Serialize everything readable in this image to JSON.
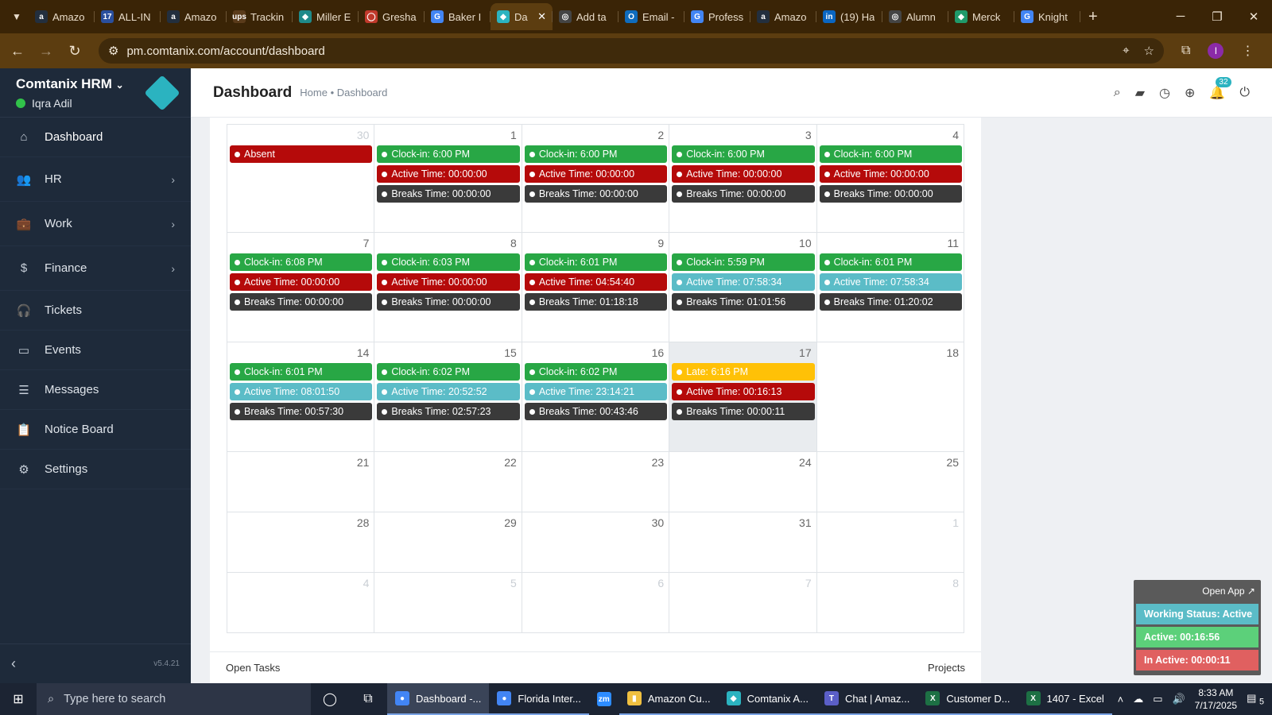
{
  "browser": {
    "tabs": [
      {
        "label": "Amazo",
        "fav": "a",
        "color": "#232f3e"
      },
      {
        "label": "ALL-IN",
        "fav": "17",
        "color": "#2a4f9e"
      },
      {
        "label": "Amazo",
        "fav": "a",
        "color": "#232f3e"
      },
      {
        "label": "Trackin",
        "fav": "ups",
        "color": "#5a3b1a"
      },
      {
        "label": "Miller E",
        "fav": "◆",
        "color": "#1f8a8a"
      },
      {
        "label": "Gresha",
        "fav": "◯",
        "color": "#c0392b"
      },
      {
        "label": "Baker I",
        "fav": "G",
        "color": "#4285f4"
      },
      {
        "label": "Da",
        "fav": "◆",
        "color": "#2bb3c0",
        "active": true
      },
      {
        "label": "Add ta",
        "fav": "◎",
        "color": "#444"
      },
      {
        "label": "Email -",
        "fav": "O",
        "color": "#0f6cbd"
      },
      {
        "label": "Profess",
        "fav": "G",
        "color": "#4285f4"
      },
      {
        "label": "Amazo",
        "fav": "a",
        "color": "#232f3e"
      },
      {
        "label": "(19) Ha",
        "fav": "in",
        "color": "#0a66c2"
      },
      {
        "label": "Alumn",
        "fav": "◎",
        "color": "#444"
      },
      {
        "label": "Merck",
        "fav": "◆",
        "color": "#1f9a6a"
      },
      {
        "label": "Knight",
        "fav": "G",
        "color": "#4285f4"
      }
    ],
    "url": "pm.comtanix.com/account/dashboard",
    "profile_initial": "I"
  },
  "sidebar": {
    "brand": "Comtanix HRM",
    "user": "Iqra Adil",
    "items": [
      {
        "label": "Dashboard",
        "icon": "home-icon",
        "glyph": "⌂",
        "chevron": false
      },
      {
        "label": "HR",
        "icon": "users-icon",
        "glyph": "👥",
        "chevron": true
      },
      {
        "label": "Work",
        "icon": "briefcase-icon",
        "glyph": "💼",
        "chevron": true
      },
      {
        "label": "Finance",
        "icon": "dollar-icon",
        "glyph": "$",
        "chevron": true
      },
      {
        "label": "Tickets",
        "icon": "headset-icon",
        "glyph": "🎧",
        "chevron": false
      },
      {
        "label": "Events",
        "icon": "calendar-icon",
        "glyph": "▭",
        "chevron": false
      },
      {
        "label": "Messages",
        "icon": "chat-icon",
        "glyph": "☰",
        "chevron": false
      },
      {
        "label": "Notice Board",
        "icon": "clipboard-icon",
        "glyph": "📋",
        "chevron": false
      },
      {
        "label": "Settings",
        "icon": "gear-icon",
        "glyph": "⚙",
        "chevron": false
      }
    ],
    "version": "v5.4.21"
  },
  "header": {
    "title": "Dashboard",
    "breadcrumb_home": "Home",
    "breadcrumb_sep": "•",
    "breadcrumb_current": "Dashboard",
    "notification_count": "32"
  },
  "colors": {
    "clockin": "#28a745",
    "active_red": "#b50a0a",
    "active_teal": "#5bbcc7",
    "breaks": "#3a3a3a",
    "late": "#ffc107",
    "absent": "#b50a0a"
  },
  "calendar": {
    "weeks": [
      {
        "height": 136,
        "days": [
          {
            "num": "30",
            "other": true,
            "events": [
              {
                "text": "Absent",
                "type": "absent"
              }
            ]
          },
          {
            "num": "1",
            "events": [
              {
                "text": "Clock-in: 6:00 PM",
                "type": "clockin"
              },
              {
                "text": "Active Time: 00:00:00",
                "type": "active_red"
              },
              {
                "text": "Breaks Time: 00:00:00",
                "type": "breaks"
              }
            ]
          },
          {
            "num": "2",
            "events": [
              {
                "text": "Clock-in: 6:00 PM",
                "type": "clockin"
              },
              {
                "text": "Active Time: 00:00:00",
                "type": "active_red"
              },
              {
                "text": "Breaks Time: 00:00:00",
                "type": "breaks"
              }
            ]
          },
          {
            "num": "3",
            "events": [
              {
                "text": "Clock-in: 6:00 PM",
                "type": "clockin"
              },
              {
                "text": "Active Time: 00:00:00",
                "type": "active_red"
              },
              {
                "text": "Breaks Time: 00:00:00",
                "type": "breaks"
              }
            ]
          },
          {
            "num": "4",
            "events": [
              {
                "text": "Clock-in: 6:00 PM",
                "type": "clockin"
              },
              {
                "text": "Active Time: 00:00:00",
                "type": "active_red"
              },
              {
                "text": "Breaks Time: 00:00:00",
                "type": "breaks"
              }
            ]
          }
        ]
      },
      {
        "height": 138,
        "days": [
          {
            "num": "7",
            "events": [
              {
                "text": "Clock-in: 6:08 PM",
                "type": "clockin"
              },
              {
                "text": "Active Time: 00:00:00",
                "type": "active_red"
              },
              {
                "text": "Breaks Time: 00:00:00",
                "type": "breaks"
              }
            ]
          },
          {
            "num": "8",
            "events": [
              {
                "text": "Clock-in: 6:03 PM",
                "type": "clockin"
              },
              {
                "text": "Active Time: 00:00:00",
                "type": "active_red"
              },
              {
                "text": "Breaks Time: 00:00:00",
                "type": "breaks"
              }
            ]
          },
          {
            "num": "9",
            "events": [
              {
                "text": "Clock-in: 6:01 PM",
                "type": "clockin"
              },
              {
                "text": "Active Time: 04:54:40",
                "type": "active_red"
              },
              {
                "text": "Breaks Time: 01:18:18",
                "type": "breaks"
              }
            ]
          },
          {
            "num": "10",
            "events": [
              {
                "text": "Clock-in: 5:59 PM",
                "type": "clockin"
              },
              {
                "text": "Active Time: 07:58:34",
                "type": "active_teal"
              },
              {
                "text": "Breaks Time: 01:01:56",
                "type": "breaks"
              }
            ]
          },
          {
            "num": "11",
            "events": [
              {
                "text": "Clock-in: 6:01 PM",
                "type": "clockin"
              },
              {
                "text": "Active Time: 07:58:34",
                "type": "active_teal"
              },
              {
                "text": "Breaks Time: 01:20:02",
                "type": "breaks"
              }
            ]
          }
        ]
      },
      {
        "height": 138,
        "days": [
          {
            "num": "14",
            "events": [
              {
                "text": "Clock-in: 6:01 PM",
                "type": "clockin"
              },
              {
                "text": "Active Time: 08:01:50",
                "type": "active_teal"
              },
              {
                "text": "Breaks Time: 00:57:30",
                "type": "breaks"
              }
            ]
          },
          {
            "num": "15",
            "events": [
              {
                "text": "Clock-in: 6:02 PM",
                "type": "clockin"
              },
              {
                "text": "Active Time: 20:52:52",
                "type": "active_teal"
              },
              {
                "text": "Breaks Time: 02:57:23",
                "type": "breaks"
              }
            ]
          },
          {
            "num": "16",
            "events": [
              {
                "text": "Clock-in: 6:02 PM",
                "type": "clockin"
              },
              {
                "text": "Active Time: 23:14:21",
                "type": "active_teal"
              },
              {
                "text": "Breaks Time: 00:43:46",
                "type": "breaks"
              }
            ]
          },
          {
            "num": "17",
            "today": true,
            "events": [
              {
                "text": "Late: 6:16 PM",
                "type": "late"
              },
              {
                "text": "Active Time: 00:16:13",
                "type": "active_red"
              },
              {
                "text": "Breaks Time: 00:00:11",
                "type": "breaks"
              }
            ]
          },
          {
            "num": "18",
            "events": []
          }
        ]
      },
      {
        "height": 76,
        "days": [
          {
            "num": "21",
            "events": []
          },
          {
            "num": "22",
            "events": []
          },
          {
            "num": "23",
            "events": []
          },
          {
            "num": "24",
            "events": []
          },
          {
            "num": "25",
            "events": []
          }
        ]
      },
      {
        "height": 76,
        "days": [
          {
            "num": "28",
            "events": []
          },
          {
            "num": "29",
            "events": []
          },
          {
            "num": "30",
            "events": []
          },
          {
            "num": "31",
            "events": []
          },
          {
            "num": "1",
            "other": true,
            "events": []
          }
        ]
      },
      {
        "height": 76,
        "days": [
          {
            "num": "4",
            "other": true,
            "events": []
          },
          {
            "num": "5",
            "other": true,
            "events": []
          },
          {
            "num": "6",
            "other": true,
            "events": []
          },
          {
            "num": "7",
            "other": true,
            "events": []
          },
          {
            "num": "8",
            "other": true,
            "events": []
          }
        ]
      }
    ]
  },
  "card_footer": {
    "left": "Open Tasks",
    "right": "Projects"
  },
  "widget": {
    "open_app": "Open App ↗",
    "working_status": "Working Status: Active",
    "active": "Active: 00:16:56",
    "inactive": "In Active: 00:00:11"
  },
  "taskbar": {
    "search_placeholder": "Type here to search",
    "apps": [
      {
        "label": "Dashboard -...",
        "ico": "●",
        "color": "#4285f4",
        "active": true
      },
      {
        "label": "Florida Inter...",
        "ico": "●",
        "color": "#4285f4"
      },
      {
        "label": "",
        "ico": "zm",
        "color": "#2d8cff",
        "plain": true
      },
      {
        "label": "Amazon Cu...",
        "ico": "▮",
        "color": "#f0c040"
      },
      {
        "label": "Comtanix A...",
        "ico": "◆",
        "color": "#2bb3c0"
      },
      {
        "label": "Chat | Amaz...",
        "ico": "T",
        "color": "#5b5fc7"
      },
      {
        "label": "Customer D...",
        "ico": "X",
        "color": "#1d7044"
      },
      {
        "label": "1407 - Excel",
        "ico": "X",
        "color": "#1d7044"
      }
    ],
    "time": "8:33 AM",
    "date": "7/17/2025",
    "notif_count": "5"
  }
}
